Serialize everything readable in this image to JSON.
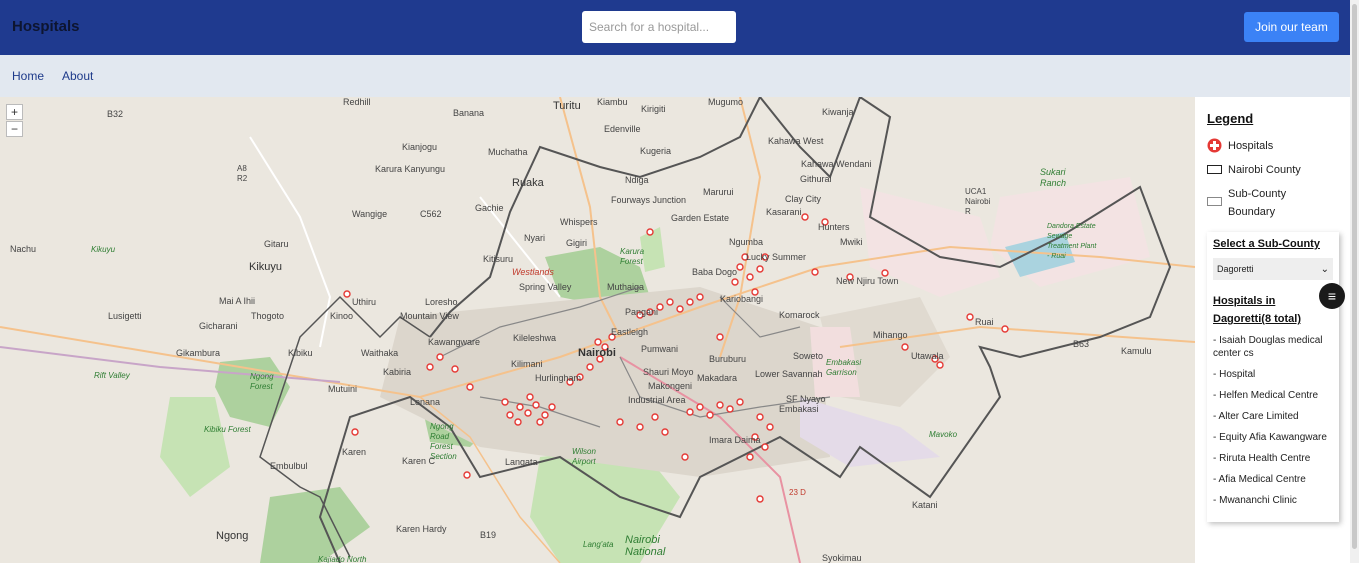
{
  "header": {
    "brand": "Hospitals",
    "search_placeholder": "Search for a hospital...",
    "join_label": "Join our team"
  },
  "nav": {
    "home": "Home",
    "about": "About"
  },
  "map": {
    "zoom_in": "+",
    "zoom_out": "−",
    "labels": {
      "redhill": "Redhill",
      "banana": "Banana",
      "turitu": "Turitu",
      "kiambu": "Kiambu",
      "kirigiti": "Kirigiti",
      "mugumo": "Mugumo",
      "kiwanja": "Kiwanja",
      "b32": "B32",
      "edenville": "Edenville",
      "kahawa_west": "Kahawa West",
      "kianjogu": "Kianjogu",
      "muchatha": "Muchatha",
      "kugeria": "Kugeria",
      "kahawa_wendani": "Kahawa Wendani",
      "karura_kanyungu": "Karura Kanyungu",
      "ruaka": "Ruaka",
      "ndiga": "Ndiga",
      "marurui": "Marurui",
      "githurai": "Githurai",
      "sukari_ranch": "Sukari Ranch",
      "a8r2": "A8 R2",
      "gachie": "Gachie",
      "fourways": "Fourways Junction",
      "clay_city": "Clay City",
      "uca1": "UCA1 Nairobi R",
      "wangige": "Wangige",
      "c562": "C562",
      "whispers": "Whispers",
      "garden_estate": "Garden Estate",
      "kasarani": "Kasarani",
      "hunters": "Hunters",
      "nachu": "Nachu",
      "gitaru": "Gitaru",
      "nyari": "Nyari",
      "gigiri": "Gigiri",
      "karura_forest": "Karura Forest",
      "ngumba": "Ngumba",
      "mwiki": "Mwiki",
      "dandora": "Dandora Estate Sewage Treatment Plant - Ruai",
      "kikuyu_rv": "Kikuyu",
      "kikuyu": "Kikuyu",
      "kitisuru": "Kitisuru",
      "westlands": "Westlands",
      "lucky_summer": "Lucky Summer",
      "spring_valley": "Spring Valley",
      "muthaiga": "Muthaiga",
      "baba_dogo": "Baba Dogo",
      "kariobangi": "Kariobangi",
      "new_njiru": "New Njiru Town",
      "mai_a_ihii": "Mai A Ihii",
      "uthiru": "Uthiru",
      "loresho": "Loresho",
      "lusigetti": "Lusigetti",
      "thogoto": "Thogoto",
      "kinoo": "Kinoo",
      "mountain_view": "Mountain View",
      "gicharani": "Gicharani",
      "ruai": "Ruai",
      "kawangware": "Kawangware",
      "kileleshwa": "Kileleshwa",
      "parklands": "Pangani",
      "eastleigh": "Eastleigh",
      "komarock": "Komarock",
      "mihango": "Mihango",
      "gikambura": "Gikambura",
      "kibiku": "Kibiku",
      "waithaka": "Waithaka",
      "nairobi": "Nairobi",
      "pumwani": "Pumwani",
      "buruburu": "Buruburu",
      "soweto": "Soweto",
      "utawala": "Utawala",
      "b63": "B63",
      "kamulu": "Kamulu",
      "rift_valley": "Rift Valley",
      "kabiria": "Kabiria",
      "kilimani": "Kilimani",
      "shauri_moyo": "Shauri Moyo",
      "embakasi_garrison": "Embakasi Garrison",
      "ngong_forest": "Ngong Forest",
      "mutuini": "Mutuini",
      "hurlingham": "Hurlingham",
      "makongeni": "Makongeni",
      "makadara": "Makadara",
      "lower_savannah": "Lower Savannah",
      "lenana": "Lenana",
      "kibiku_forest": "Kibiku Forest",
      "ngong_road": "Ngong Road Forest Section",
      "industrial": "Industrial Area",
      "sf_nyayo": "SF Nyayo",
      "embakasi": "Embakasi",
      "karen": "Karen",
      "karen_c": "Karen C",
      "wilson": "Wilson Airport",
      "imara_daima": "Imara Daima",
      "embulbul": "Embulbul",
      "langata": "Langata",
      "katani": "Katani",
      "karen_hardy": "Karen Hardy",
      "b19": "B19",
      "ngong": "Ngong",
      "kajiado_north": "Kajiado North",
      "langata2": "Lang'ata",
      "nairobi_np": "Nairobi National",
      "syokimau": "Syokimau",
      "mavoko": "Mavoko",
      "r23d": "23 D"
    }
  },
  "legend": {
    "title": "Legend",
    "hospitals": "Hospitals",
    "county": "Nairobi County",
    "subcounty": "Sub-County Boundary"
  },
  "subcounty_card": {
    "title": "Select a Sub-County",
    "selected": "Dagoretti",
    "list_title": "Hospitals in Dagoretti(8 total)",
    "hospitals": [
      "- Isaiah Douglas medical center cs",
      "- Hospital",
      "- Helfen Medical Centre",
      "- Alter Care Limited",
      "- Equity Afia Kawangware",
      "- Riruta Health Centre",
      "- Afia Medical Centre",
      "- Mwananchi Clinic"
    ]
  },
  "colors": {
    "header": "#1f3a8f",
    "nav": "#e2e8f0",
    "button": "#3b82f6",
    "marker": "#e53935"
  },
  "icons": {
    "fab": "list-filter-icon",
    "hospital": "hospital-cross-icon"
  }
}
